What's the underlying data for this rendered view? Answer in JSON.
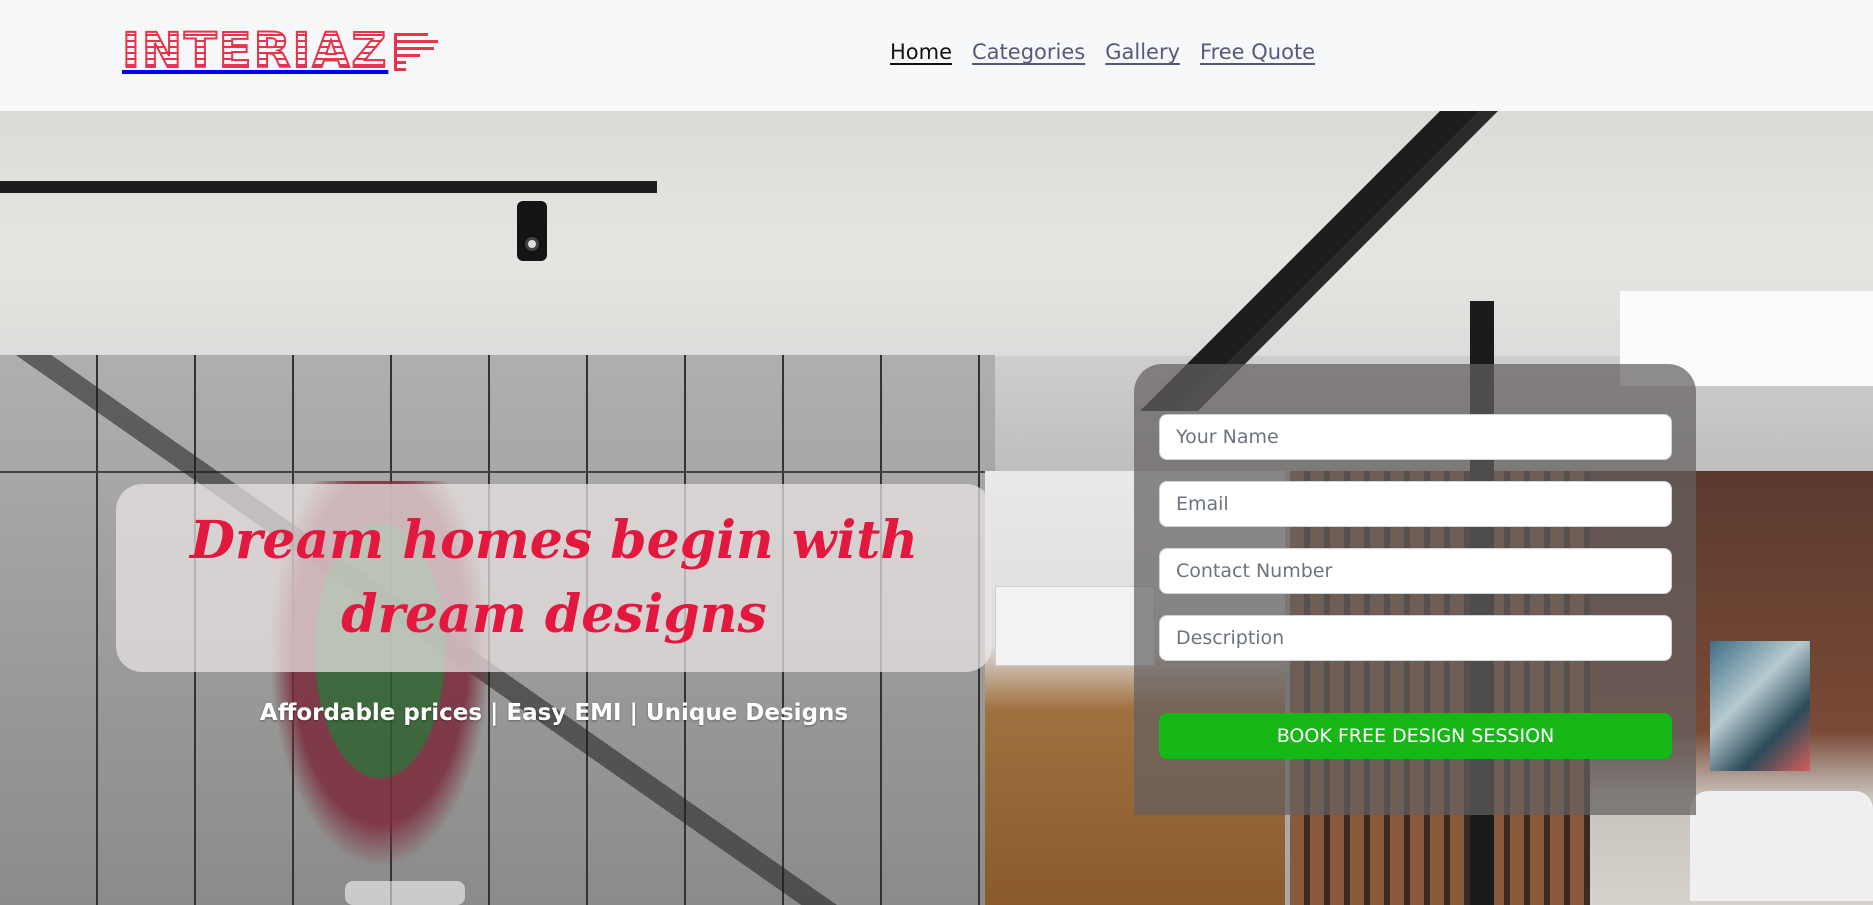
{
  "header": {
    "logo_text": "INTERIAZ",
    "nav": [
      {
        "label": "Home",
        "active": true
      },
      {
        "label": "Categories",
        "active": false
      },
      {
        "label": "Gallery",
        "active": false
      },
      {
        "label": "Free Quote",
        "active": false
      }
    ]
  },
  "hero": {
    "headline": "Dream homes begin with dream designs",
    "subline": "Affordable prices | Easy EMI | Unique Designs"
  },
  "form": {
    "name_placeholder": "Your Name",
    "email_placeholder": "Email",
    "contact_placeholder": "Contact Number",
    "description_placeholder": "Description",
    "submit_label": "BOOK FREE DESIGN SESSION"
  },
  "colors": {
    "brand": "#e8334a",
    "headline": "#e3183e",
    "button": "#18b718",
    "nav_link": "#555a7a"
  },
  "icons": {
    "logo_mark": "striped-arrow-logo-icon"
  }
}
